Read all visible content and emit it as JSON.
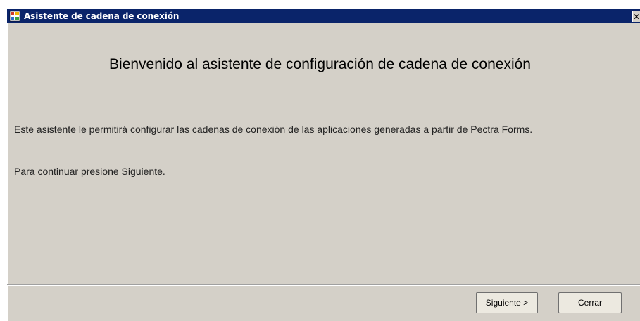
{
  "window": {
    "title": "Asistente de cadena de conexión",
    "close_glyph": "✕",
    "icon": "app-window-icon"
  },
  "content": {
    "heading": "Bienvenido al asistente de configuración de cadena de conexión",
    "paragraph1": "Este asistente le permitirá configurar las cadenas de conexión de las aplicaciones generadas a partir de Pectra Forms.",
    "paragraph2": "Para continuar presione Siguiente."
  },
  "buttons": {
    "next_label": "Siguiente >",
    "close_label": "Cerrar"
  },
  "colors": {
    "titlebar": "#0a246a",
    "dialog_bg": "#d4d0c8"
  }
}
